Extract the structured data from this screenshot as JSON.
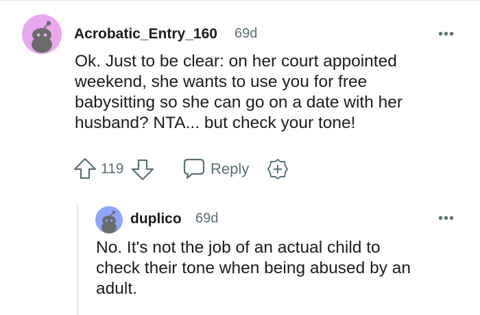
{
  "comment": {
    "username": "Acrobatic_Entry_160",
    "age": "69d",
    "avatar_icon": "snoo-avatar-icon",
    "body_lines": [
      "Ok. Just to be clear: on her court appointed",
      "weekend, she wants to use you for free",
      "babysitting so she can go on a date with her",
      "husband? NTA... but check your tone!"
    ],
    "score": "119",
    "reply_label": "Reply",
    "more_label": "•••"
  },
  "reply": {
    "username": "duplico",
    "age": "69d",
    "avatar_icon": "snoo-avatar-icon",
    "body_lines": [
      "No. It's not the job of an actual child to",
      "check their tone when being abused by an",
      "adult."
    ],
    "more_label": "•••"
  },
  "colors": {
    "meta": "#576f76",
    "avatar_bg_1": "#e9a7f0",
    "avatar_bg_2": "#8fa5ff",
    "thread_line": "#e5ebee"
  }
}
